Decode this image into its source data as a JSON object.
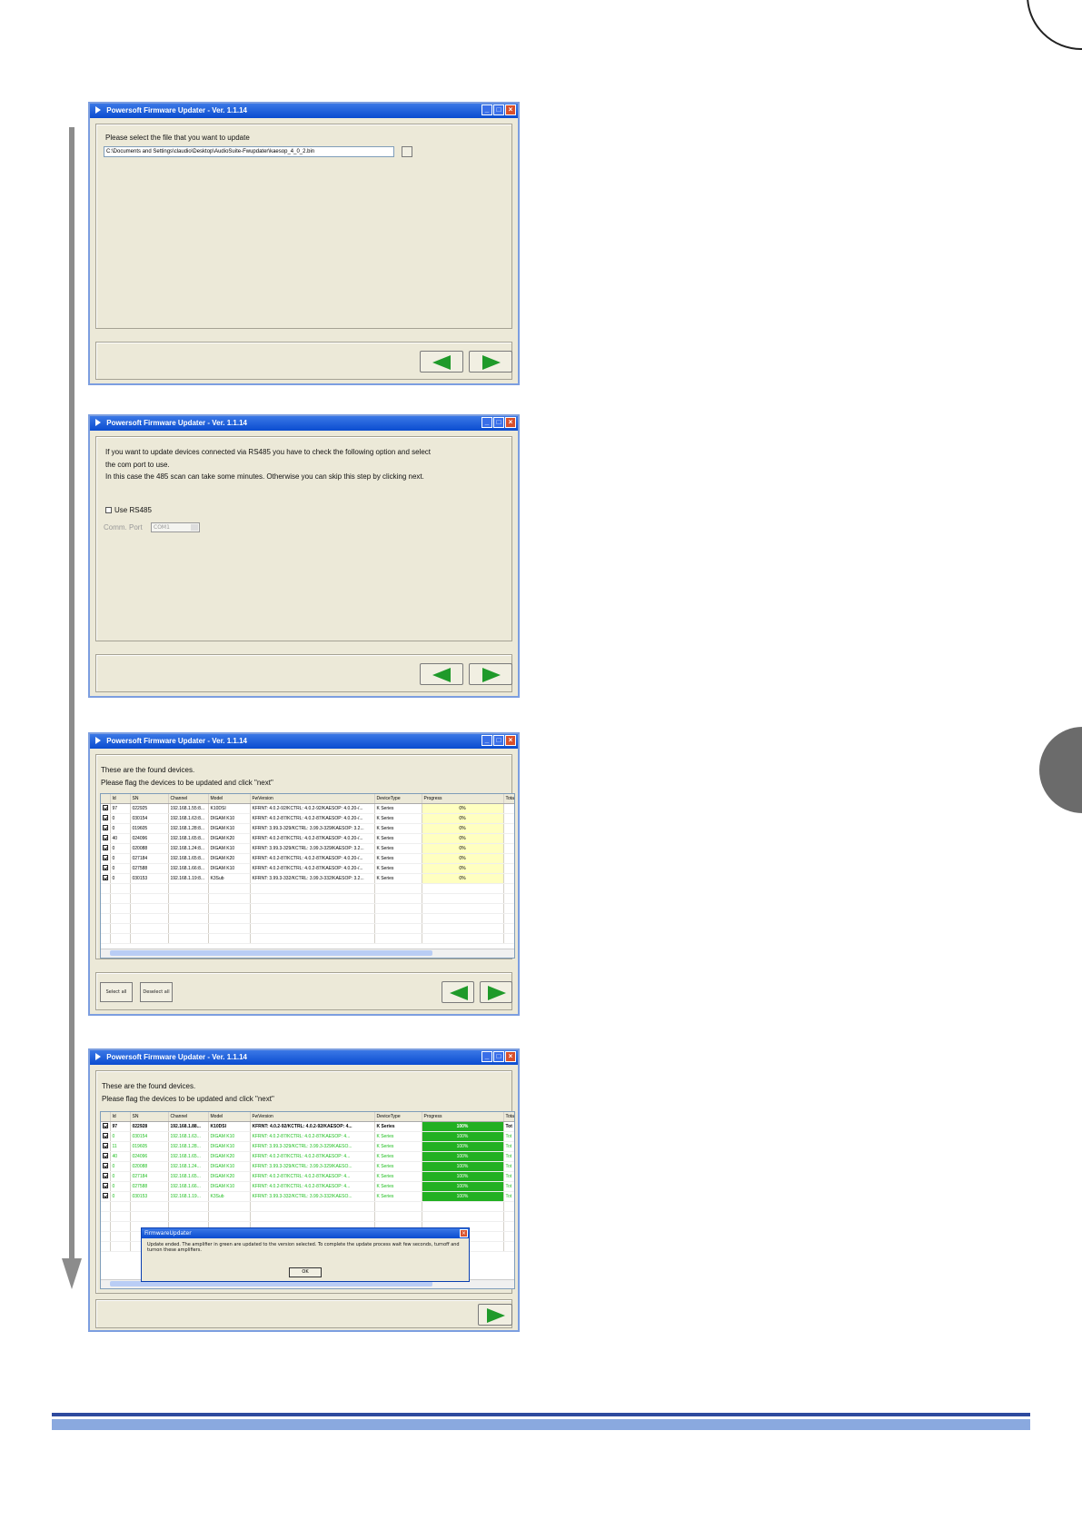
{
  "app": {
    "window_title": "Powersoft Firmware Updater - Ver. 1.1.14"
  },
  "step1": {
    "prompt": "Please select the file that you want to update",
    "file_path": "C:\\Documents and Settings\\claudio\\Desktop\\AudioSuite-Fwupdater\\kaesop_4_0_2.bin"
  },
  "step2": {
    "info_line1": "If you want to update devices connected via RS485 you have to check the following option and select",
    "info_line2": "the com port to use.",
    "info_line3": "In this case the 485 scan can take some minutes. Otherwise you can skip this step by clicking next.",
    "use_rs485_label": "Use RS485",
    "comm_port_label": "Comm. Port",
    "comm_port_value": "COM1"
  },
  "step3": {
    "info_line1": "These are the found devices.",
    "info_line2": "Please flag the devices to be updated and click \"next\"",
    "select_all_label": "Select all",
    "deselect_all_label": "Deselect all"
  },
  "step4": {
    "info_line1": "These are the found devices.",
    "info_line2": "Please flag the devices to be updated and click \"next\""
  },
  "table": {
    "headers": [
      "",
      "Id",
      "SN",
      "Channel",
      "Model",
      "FwVersion",
      "DeviceType",
      "Progress",
      "Total"
    ],
    "rows3": [
      {
        "id": "97",
        "sn": "022925",
        "ch": "192.168.1.55:8...",
        "model": "K10DSI",
        "fw": "KFRNT: 4.0.2-92/KCTRL: 4.0.2-92/KAESOP: 4.0.20-/...",
        "type": "K Series",
        "prog": "0%"
      },
      {
        "id": "0",
        "sn": "030154",
        "ch": "192.168.1.63:8...",
        "model": "DIGAM K10",
        "fw": "KFRNT: 4.0.2-87/KCTRL: 4.0.2-87/KAESOP: 4.0.20-/...",
        "type": "K Series",
        "prog": "0%"
      },
      {
        "id": "0",
        "sn": "019605",
        "ch": "192.168.1.28:8...",
        "model": "DIGAM K10",
        "fw": "KFRNT: 3.99.3-329/KCTRL: 3.99.3-329/KAESOP: 3.2...",
        "type": "K Series",
        "prog": "0%"
      },
      {
        "id": "40",
        "sn": "024096",
        "ch": "192.168.1.65:8...",
        "model": "DIGAM K20",
        "fw": "KFRNT: 4.0.2-87/KCTRL: 4.0.2-87/KAESOP: 4.0.20-/...",
        "type": "K Series",
        "prog": "0%"
      },
      {
        "id": "0",
        "sn": "020088",
        "ch": "192.168.1.24:8...",
        "model": "DIGAM K10",
        "fw": "KFRNT: 3.99.3-329/KCTRL: 3.99.3-329/KAESOP: 3.2...",
        "type": "K Series",
        "prog": "0%"
      },
      {
        "id": "0",
        "sn": "027184",
        "ch": "192.168.1.65:8...",
        "model": "DIGAM K20",
        "fw": "KFRNT: 4.0.2-87/KCTRL: 4.0.2-87/KAESOP: 4.0.20-/...",
        "type": "K Series",
        "prog": "0%"
      },
      {
        "id": "0",
        "sn": "027588",
        "ch": "192.168.1.66:8...",
        "model": "DIGAM K10",
        "fw": "KFRNT: 4.0.2-87/KCTRL: 4.0.2-87/KAESOP: 4.0.20-/...",
        "type": "K Series",
        "prog": "0%"
      },
      {
        "id": "0",
        "sn": "030153",
        "ch": "192.168.1.19:8...",
        "model": "K3Sub",
        "fw": "KFRNT: 3.99.3-332/KCTRL: 3.99.3-332/KAESOP: 3.2...",
        "type": "K Series",
        "prog": "0%"
      }
    ],
    "rows4": [
      {
        "id": "97",
        "sn": "022928",
        "ch": "192.168.1.88...",
        "model": "K10DSI",
        "fw": "KFRNT: 4.0.2-92/KCTRL: 4.0.2-92/KAESOP: 4...",
        "type": "K Series",
        "prog": "100%",
        "tot": "Tot"
      },
      {
        "id": "0",
        "sn": "030154",
        "ch": "192.168.1.63...",
        "model": "DIGAM K10",
        "fw": "KFRNT: 4.0.2-87/KCTRL: 4.0.2-87/KAESOP: 4...",
        "type": "K Series",
        "prog": "100%",
        "tot": "Tot"
      },
      {
        "id": "11",
        "sn": "019605",
        "ch": "192.168.1.28...",
        "model": "DIGAM K10",
        "fw": "KFRNT: 3.99.3-329/KCTRL: 3.99.3-329/KAESO...",
        "type": "K Series",
        "prog": "100%",
        "tot": "Tot"
      },
      {
        "id": "40",
        "sn": "024096",
        "ch": "192.168.1.65...",
        "model": "DIGAM K20",
        "fw": "KFRNT: 4.0.2-87/KCTRL: 4.0.2-87/KAESOP: 4...",
        "type": "K Series",
        "prog": "100%",
        "tot": "Tot"
      },
      {
        "id": "0",
        "sn": "020088",
        "ch": "192.168.1.24...",
        "model": "DIGAM K10",
        "fw": "KFRNT: 3.99.3-329/KCTRL: 3.99.3-329/KAESO...",
        "type": "K Series",
        "prog": "100%",
        "tot": "Tot"
      },
      {
        "id": "0",
        "sn": "027184",
        "ch": "192.168.1.65...",
        "model": "DIGAM K20",
        "fw": "KFRNT: 4.0.2-87/KCTRL: 4.0.2-87/KAESOP: 4...",
        "type": "K Series",
        "prog": "100%",
        "tot": "Tot"
      },
      {
        "id": "0",
        "sn": "027588",
        "ch": "192.168.1.66...",
        "model": "DIGAM K10",
        "fw": "KFRNT: 4.0.2-87/KCTRL: 4.0.2-87/KAESOP: 4...",
        "type": "K Series",
        "prog": "100%",
        "tot": "Tot"
      },
      {
        "id": "0",
        "sn": "030153",
        "ch": "192.168.1.19...",
        "model": "K3Sub",
        "fw": "KFRNT: 3.99.3-332/KCTRL: 3.99.3-332/KAESO...",
        "type": "K Series",
        "prog": "100%",
        "tot": "Tot"
      }
    ]
  },
  "dialog": {
    "title": "FirmwareUpdater",
    "message": "Update ended. The amplifier in green are updated to the version selected. To complete the update process wait few seconds, turnoff and turnon these amplifiers.",
    "ok_label": "OK"
  },
  "colors": {
    "titlebar": "#0a4cd0",
    "window_bg": "#ece9d8",
    "progress_pending": "#ffffc0",
    "progress_done": "#22b022",
    "updated_text": "#1fbf1f",
    "footer_dark": "#2e4a9e",
    "footer_light": "#8aa9df"
  }
}
